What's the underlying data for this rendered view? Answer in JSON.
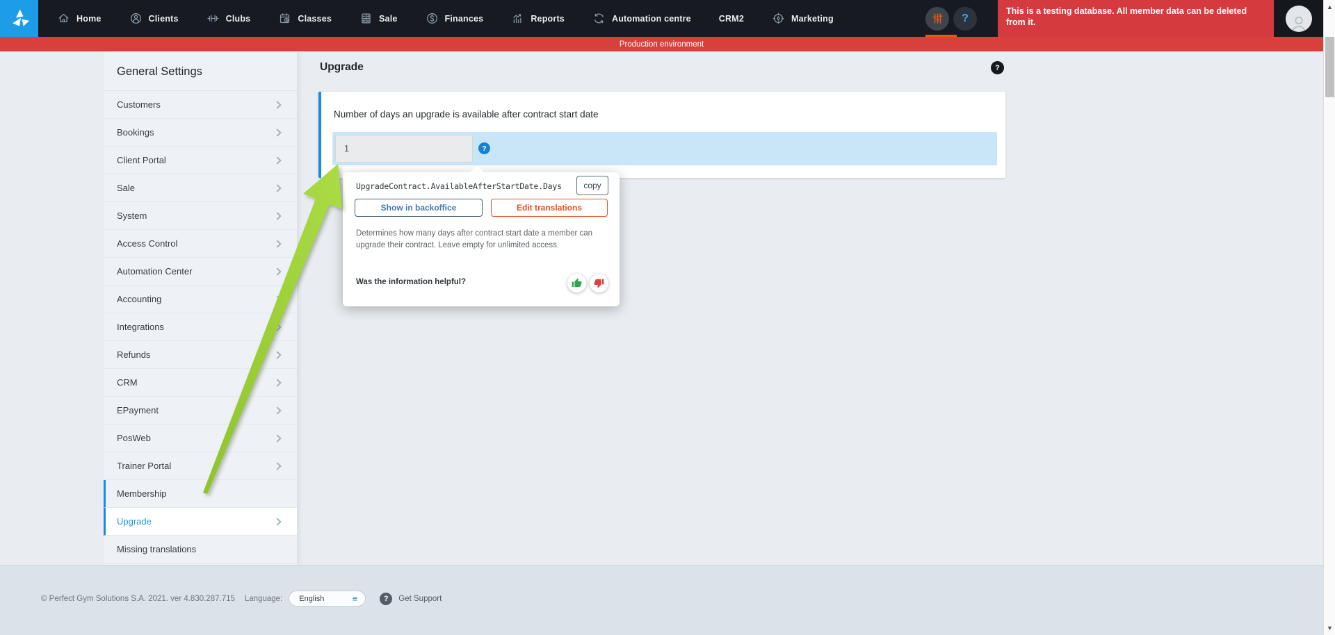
{
  "nav": {
    "items": [
      {
        "label": "Home",
        "icon": "home-icon"
      },
      {
        "label": "Clients",
        "icon": "clients-icon"
      },
      {
        "label": "Clubs",
        "icon": "clubs-icon"
      },
      {
        "label": "Classes",
        "icon": "classes-icon"
      },
      {
        "label": "Sale",
        "icon": "sale-icon"
      },
      {
        "label": "Finances",
        "icon": "finances-icon"
      },
      {
        "label": "Reports",
        "icon": "reports-icon"
      },
      {
        "label": "Automation centre",
        "icon": "automation-icon"
      },
      {
        "label": "CRM2",
        "icon": null
      },
      {
        "label": "Marketing",
        "icon": "marketing-icon"
      }
    ],
    "banner_text": "This is a testing database. All member data can be deleted from it.",
    "env_label": "Production environment"
  },
  "sidebar": {
    "title": "General Settings",
    "items": [
      {
        "label": "Customers",
        "chevron": true,
        "active": false,
        "grouped": false
      },
      {
        "label": "Bookings",
        "chevron": true,
        "active": false,
        "grouped": false
      },
      {
        "label": "Client Portal",
        "chevron": true,
        "active": false,
        "grouped": false
      },
      {
        "label": "Sale",
        "chevron": true,
        "active": false,
        "grouped": false
      },
      {
        "label": "System",
        "chevron": true,
        "active": false,
        "grouped": false
      },
      {
        "label": "Access Control",
        "chevron": true,
        "active": false,
        "grouped": false
      },
      {
        "label": "Automation Center",
        "chevron": true,
        "active": false,
        "grouped": false
      },
      {
        "label": "Accounting",
        "chevron": true,
        "active": false,
        "grouped": false
      },
      {
        "label": "Integrations",
        "chevron": true,
        "active": false,
        "grouped": false
      },
      {
        "label": "Refunds",
        "chevron": true,
        "active": false,
        "grouped": false
      },
      {
        "label": "CRM",
        "chevron": true,
        "active": false,
        "grouped": false
      },
      {
        "label": "EPayment",
        "chevron": true,
        "active": false,
        "grouped": false
      },
      {
        "label": "PosWeb",
        "chevron": true,
        "active": false,
        "grouped": false
      },
      {
        "label": "Trainer Portal",
        "chevron": true,
        "active": false,
        "grouped": false
      },
      {
        "label": "Membership",
        "chevron": false,
        "active": false,
        "grouped": true
      },
      {
        "label": "Upgrade",
        "chevron": true,
        "active": true,
        "grouped": true
      },
      {
        "label": "Missing translations",
        "chevron": false,
        "active": false,
        "grouped": false
      }
    ]
  },
  "main": {
    "title": "Upgrade",
    "help_glyph": "?",
    "card": {
      "label": "Number of days an upgrade is available after contract start date",
      "input_value": "1",
      "help_glyph": "?"
    },
    "popup": {
      "translation_key": "UpgradeContract.AvailableAfterStartDate.Days",
      "copy_label": "copy",
      "show_backoffice_label": "Show in backoffice",
      "edit_translations_label": "Edit translations",
      "description": "Determines how many days after contract start date a member can upgrade their contract. Leave empty for unlimited access.",
      "feedback_question": "Was the information helpful?"
    }
  },
  "footer": {
    "copyright": "© Perfect Gym Solutions S.A. 2021. ver 4.830.287.715",
    "language_label": "Language:",
    "language_value": "English",
    "support_label": "Get Support"
  },
  "colors": {
    "accent_blue": "#1e88e5",
    "link_blue": "#2196f3",
    "logo_blue": "#1d9ce8",
    "alert_red": "#d53a3e",
    "env_red": "#d8403e",
    "warning_orange": "#e8531f",
    "success_green": "#2ba84a",
    "danger_red": "#e04040",
    "annotation_green": "#96ca35"
  }
}
